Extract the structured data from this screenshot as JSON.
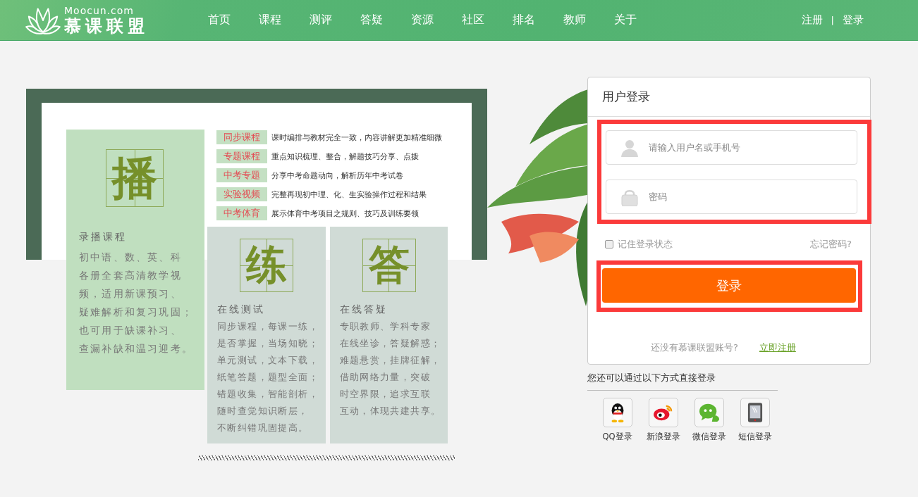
{
  "header": {
    "logo": {
      "domain": "Moocun.com",
      "name": "慕课联盟"
    },
    "nav": [
      {
        "label": "首页"
      },
      {
        "label": "课程"
      },
      {
        "label": "测评"
      },
      {
        "label": "答疑"
      },
      {
        "label": "资源"
      },
      {
        "label": "社区"
      },
      {
        "label": "排名"
      },
      {
        "label": "教师"
      },
      {
        "label": "关于"
      }
    ],
    "auth": {
      "register": "注册",
      "separator": "|",
      "login": "登录"
    }
  },
  "banner": {
    "main_card": {
      "character": "播",
      "title": "录播课程",
      "lines": [
        "初中语、数、英、科",
        "各册全套高清教学视",
        "频，适用新课预习、",
        "疑难解析和复习巩固；",
        "也可用于缺课补习、",
        "查漏补缺和温习迎考。"
      ]
    },
    "features": [
      {
        "tag": "同步课程",
        "description": "课时编排与教材完全一致，内容讲解更加精准细微"
      },
      {
        "tag": "专题课程",
        "description": "重点知识梳理、整合，解题技巧分享、点拨"
      },
      {
        "tag": "中考专题",
        "description": "分享中考命题动向，解析历年中考试卷"
      },
      {
        "tag": "实验视频",
        "description": "完整再现初中理、化、生实验操作过程和结果"
      },
      {
        "tag": "中考体育",
        "description": "展示体育中考项目之规则、技巧及训练要领"
      }
    ],
    "cards": [
      {
        "character": "练",
        "title": "在线测试",
        "lines": [
          "同步课程，每课一练，",
          "是否掌握，当场知晓；",
          "单元测试，文本下载，",
          "纸笔答题，题型全面；",
          "错题收集，智能剖析，",
          "随时查觉知识断层，",
          "不断纠错巩固提高。"
        ]
      },
      {
        "character": "答",
        "title": "在线答疑",
        "lines": [
          "专职教师、学科专家",
          "在线坐诊，答疑解惑；",
          "难题悬赏，挂牌征解，",
          "借助网络力量，突破",
          "时空界限，追求互联",
          "互动，体现共建共享。"
        ]
      }
    ]
  },
  "login": {
    "title": "用户登录",
    "fields": [
      {
        "kind": "user",
        "placeholder": "请输入用户名或手机号"
      },
      {
        "kind": "password",
        "placeholder": "密码"
      }
    ],
    "remember": {
      "label": "记住登录状态",
      "checked": false
    },
    "forgot": "忘记密码?",
    "submit": "登录",
    "register": {
      "prompt": "还没有慕课联盟账号?",
      "link": "立即注册"
    },
    "social": {
      "heading": "您还可以通过以下方式直接登录",
      "items": [
        {
          "kind": "qq",
          "label": "QQ登录"
        },
        {
          "kind": "weibo",
          "label": "新浪登录"
        },
        {
          "kind": "wechat",
          "label": "微信登录"
        },
        {
          "kind": "sms",
          "label": "短信登录"
        }
      ]
    }
  }
}
